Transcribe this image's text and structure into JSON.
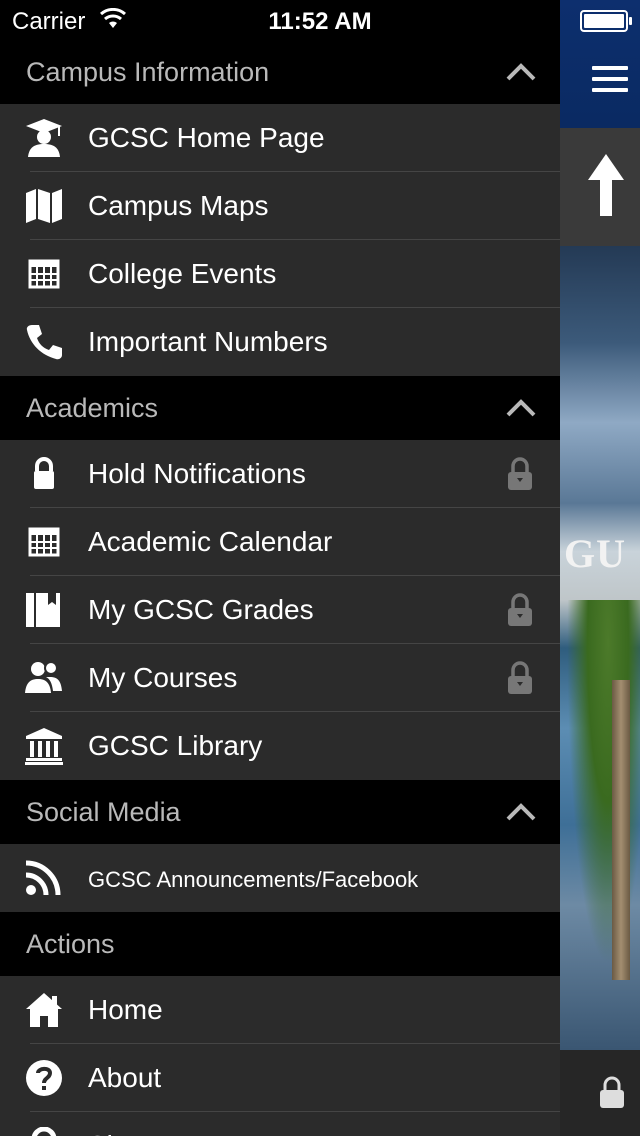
{
  "status_bar": {
    "carrier": "Carrier",
    "time": "11:52 AM"
  },
  "sections": [
    {
      "title": "Campus Information",
      "items": [
        {
          "label": "GCSC Home Page",
          "icon": "graduate-icon",
          "locked": false
        },
        {
          "label": "Campus Maps",
          "icon": "map-icon",
          "locked": false
        },
        {
          "label": "College Events",
          "icon": "calendar-icon",
          "locked": false
        },
        {
          "label": "Important Numbers",
          "icon": "phone-icon",
          "locked": false
        }
      ]
    },
    {
      "title": "Academics",
      "items": [
        {
          "label": "Hold Notifications",
          "icon": "lock-icon",
          "locked": true
        },
        {
          "label": "Academic Calendar",
          "icon": "calendar-icon",
          "locked": false
        },
        {
          "label": "My GCSC Grades",
          "icon": "book-icon",
          "locked": true
        },
        {
          "label": "My Courses",
          "icon": "users-icon",
          "locked": true
        },
        {
          "label": "GCSC Library",
          "icon": "library-icon",
          "locked": false
        }
      ]
    },
    {
      "title": "Social Media",
      "items": [
        {
          "label": "GCSC Announcements/Facebook",
          "icon": "rss-icon",
          "locked": false
        }
      ]
    },
    {
      "title": "Actions",
      "items": [
        {
          "label": "Home",
          "icon": "home-icon",
          "locked": false
        },
        {
          "label": "About",
          "icon": "help-icon",
          "locked": false
        },
        {
          "label": "Sign In",
          "icon": "key-icon",
          "locked": false
        }
      ]
    }
  ],
  "background": {
    "banner_text": "GU"
  },
  "colors": {
    "drawer": "#2b2b2b",
    "header": "#000000",
    "section_title": "#b9b9b9",
    "nav_blue": "#0d2f6e"
  }
}
